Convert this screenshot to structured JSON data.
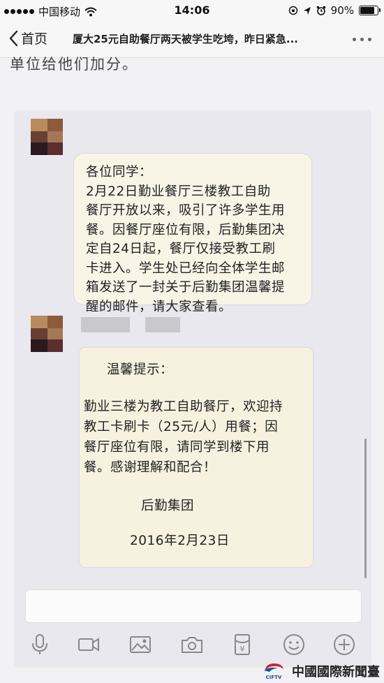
{
  "status_bar": {
    "carrier": "中国移动",
    "time": "14:06",
    "battery": "90%",
    "battery_level": 0.9
  },
  "nav": {
    "back_label": "首页",
    "title": "厦大25元自助餐厅两天被学生吃垮，昨日紧急..."
  },
  "article_bleed": "单位给他们加分。",
  "chat": {
    "message1": {
      "lines": [
        "各位同学：",
        "  2月22日勤业餐厅三楼教工自助",
        "餐厅开放以来，吸引了许多学生用",
        "餐。因餐厅座位有限，后勤集团决",
        "定自24日起，餐厅仅接受教工刷",
        "卡进入。学生处已经向全体学生邮",
        "箱发送了一封关于后勤集团温馨提",
        "醒的邮件，请大家查看。"
      ]
    },
    "message2": {
      "heading": "温馨提示：",
      "body": [
        "勤业三楼为教工自助餐厅，欢迎持",
        "教工卡刷卡（25元/人）用餐；因",
        "餐厅座位有限，请同学到楼下用",
        "餐。感谢理解和配合！"
      ],
      "signature": "后勤集团",
      "date": "2016年2月23日"
    }
  },
  "toolbar": {
    "icons": [
      "microphone-icon",
      "video-icon",
      "image-icon",
      "camera-icon",
      "red-packet-icon",
      "emoji-icon",
      "plus-icon"
    ]
  },
  "watermark": {
    "text": "中國國際新聞臺",
    "logo_text": "CIFTV"
  },
  "colors": {
    "bubble": "#f8f5e7",
    "panel": "#e9e8ef",
    "watermark_red": "#d0202a",
    "watermark_blue": "#1b4fa0"
  }
}
